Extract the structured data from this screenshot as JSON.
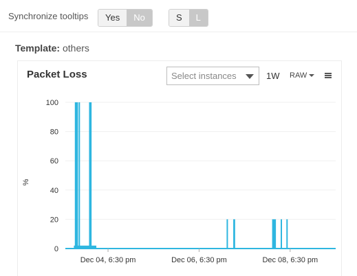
{
  "toolbar": {
    "sync_label": "Synchronize tooltips",
    "sync_yes": "Yes",
    "sync_no": "No",
    "size_s": "S",
    "size_l": "L"
  },
  "template": {
    "label": "Template:",
    "value": "others"
  },
  "panel": {
    "title": "Packet Loss",
    "select_placeholder": "Select instances",
    "range": "1W",
    "mode": "RAW"
  },
  "colors": {
    "series": "#2eb6e0",
    "grid": "#efefef",
    "axis": "#2eb6e0"
  },
  "chart_data": {
    "type": "bar",
    "ylabel": "%",
    "ylim": [
      0,
      100
    ],
    "yticks": [
      0,
      20,
      40,
      60,
      80,
      100
    ],
    "xlim": [
      "Dec 03, 08:00 pm",
      "Dec 09, 06:30 pm"
    ],
    "xtick_labels": [
      "Dec 04, 6:30 pm",
      "Dec 06, 6:30 pm",
      "Dec 08, 6:30 pm"
    ],
    "baseline": 0,
    "series": [
      {
        "bars": [
          {
            "start": "Dec 04, 01:00 am",
            "end": "Dec 04, 02:40 am",
            "value": 100
          },
          {
            "start": "Dec 04, 03:00 am",
            "end": "Dec 04, 03:20 am",
            "value": 100
          },
          {
            "start": "Dec 04, 08:30 am",
            "end": "Dec 04, 09:50 am",
            "value": 100
          },
          {
            "start": "Dec 04, 12:30 am",
            "end": "Dec 04, 12:20 pm",
            "value": 2
          },
          {
            "start": "Dec 07, 09:00 am",
            "end": "Dec 07, 09:20 am",
            "value": 20
          },
          {
            "start": "Dec 07, 12:30 pm",
            "end": "Dec 07, 01:30 pm",
            "value": 20
          },
          {
            "start": "Dec 08, 09:00 am",
            "end": "Dec 08, 11:00 am",
            "value": 20
          },
          {
            "start": "Dec 08, 01:30 pm",
            "end": "Dec 08, 01:50 pm",
            "value": 20
          },
          {
            "start": "Dec 08, 04:30 pm",
            "end": "Dec 08, 05:10 pm",
            "value": 20
          }
        ]
      }
    ]
  }
}
